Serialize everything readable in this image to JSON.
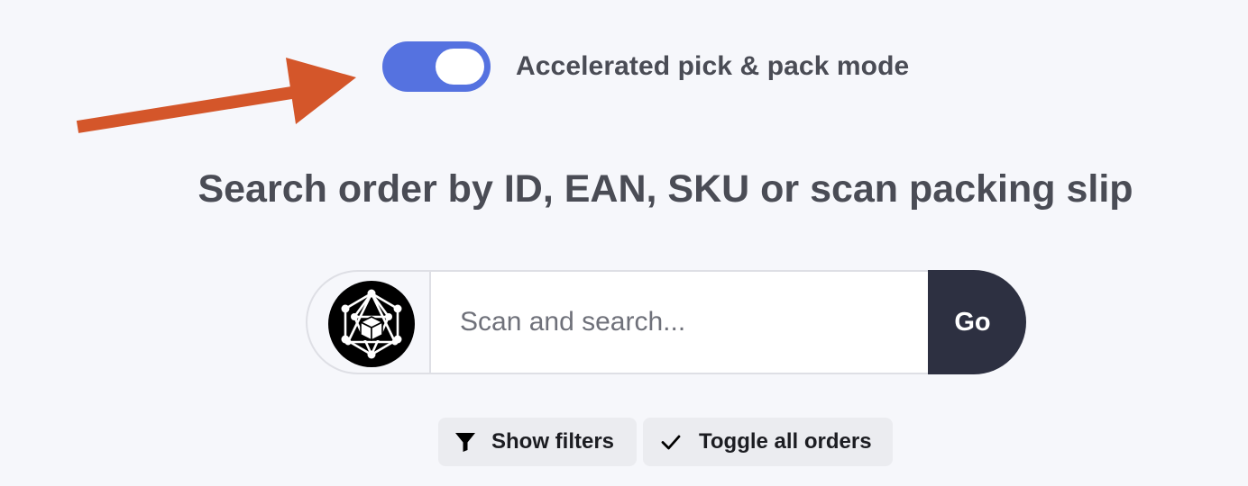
{
  "colors": {
    "page_background": "#f6f7fb",
    "toggle_on": "#5572e0",
    "arrow": "#d4562a",
    "go_button": "#2d3041",
    "heading_text": "#4a4c55",
    "secondary_button": "#ebecf0"
  },
  "annotation": {
    "icon": "arrow-pointing-right-icon"
  },
  "mode_toggle": {
    "label": "Accelerated pick & pack mode",
    "state": "on"
  },
  "heading": "Search order by ID, EAN, SKU or scan packing slip",
  "search": {
    "scan_icon": "scanner-cube-icon",
    "placeholder": "Scan and search...",
    "value": "",
    "go_label": "Go"
  },
  "actions": {
    "show_filters": {
      "label": "Show filters",
      "icon": "filter-icon"
    },
    "toggle_all_orders": {
      "label": "Toggle all orders",
      "icon": "checkmark-icon"
    }
  }
}
